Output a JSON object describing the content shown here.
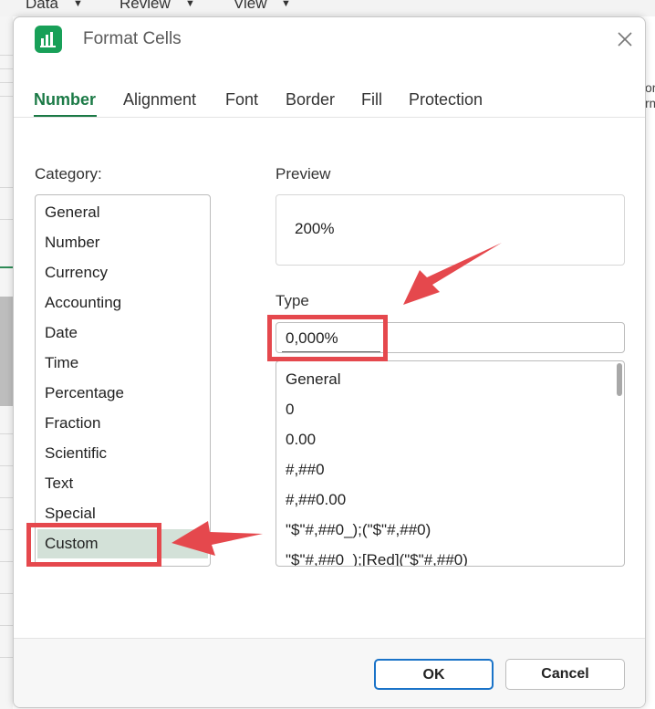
{
  "background": {
    "menu": [
      "Data",
      "Review",
      "View"
    ],
    "right_fragment": [
      "or",
      "rm"
    ]
  },
  "dialog": {
    "title": "Format Cells",
    "app_icon": "spreadsheet-app-icon",
    "close_icon": "close-icon"
  },
  "tabs": [
    {
      "label": "Number",
      "active": true
    },
    {
      "label": "Alignment",
      "active": false
    },
    {
      "label": "Font",
      "active": false
    },
    {
      "label": "Border",
      "active": false
    },
    {
      "label": "Fill",
      "active": false
    },
    {
      "label": "Protection",
      "active": false
    }
  ],
  "category": {
    "label": "Category:",
    "items": [
      "General",
      "Number",
      "Currency",
      "Accounting",
      "Date",
      "Time",
      "Percentage",
      "Fraction",
      "Scientific",
      "Text",
      "Special",
      "Custom"
    ],
    "selected": "Custom"
  },
  "preview": {
    "label": "Preview",
    "value": "200%"
  },
  "type": {
    "label": "Type",
    "value": "0,000%",
    "items": [
      "General",
      "0",
      "0.00",
      "#,##0",
      "#,##0.00",
      "\"$\"#,##0_);(\"$\"#,##0)",
      "\"$\"#,##0_);[Red](\"$\"#,##0)"
    ]
  },
  "buttons": {
    "ok": "OK",
    "cancel": "Cancel"
  },
  "colors": {
    "accent": "#1b7a46",
    "selected_bg": "#d3e1d8",
    "annotation": "#e5484d",
    "ok_border": "#1a73c8"
  }
}
